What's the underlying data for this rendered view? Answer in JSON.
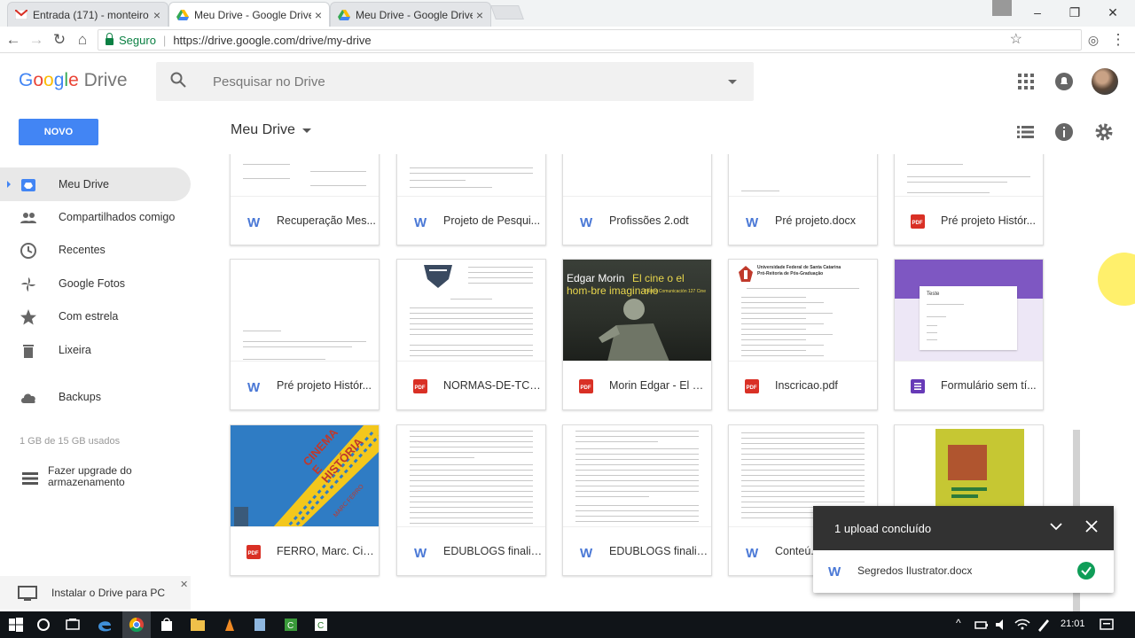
{
  "browser": {
    "tabs": [
      {
        "title": "Entrada (171) - monteiro",
        "icon": "gmail-icon"
      },
      {
        "title": "Meu Drive - Google Drive",
        "icon": "drive-icon",
        "active": true
      },
      {
        "title": "Meu Drive - Google Drive",
        "icon": "drive-icon"
      }
    ],
    "secure_label": "Seguro",
    "url": "https://drive.google.com/drive/my-drive"
  },
  "header": {
    "logo_google": "Google",
    "logo_drive": "Drive",
    "search_placeholder": "Pesquisar no Drive"
  },
  "toolbar": {
    "new_label": "NOVO",
    "title": "Meu Drive"
  },
  "sidebar": {
    "items": [
      {
        "label": "Meu Drive",
        "icon": "drive-icon"
      },
      {
        "label": "Compartilhados comigo",
        "icon": "people-icon"
      },
      {
        "label": "Recentes",
        "icon": "clock-icon"
      },
      {
        "label": "Google Fotos",
        "icon": "photos-icon"
      },
      {
        "label": "Com estrela",
        "icon": "star-icon"
      },
      {
        "label": "Lixeira",
        "icon": "trash-icon"
      },
      {
        "label": "Backups",
        "icon": "cloud-icon"
      }
    ],
    "storage": "1 GB de 15 GB usados",
    "upgrade_line1": "Fazer upgrade do",
    "upgrade_line2": "armazenamento",
    "install": "Instalar o Drive para PC"
  },
  "files": [
    {
      "name": "Recuperação Mes...",
      "type": "word"
    },
    {
      "name": "Projeto de Pesqui...",
      "type": "word"
    },
    {
      "name": "Profissões 2.odt",
      "type": "word"
    },
    {
      "name": "Pré projeto.docx",
      "type": "word"
    },
    {
      "name": "Pré projeto Histór...",
      "type": "pdf"
    },
    {
      "name": "Pré projeto Histór...",
      "type": "word"
    },
    {
      "name": "NORMAS-DE-TCC...",
      "type": "pdf"
    },
    {
      "name": "Morin Edgar - El C...",
      "type": "pdf"
    },
    {
      "name": "Inscricao.pdf",
      "type": "pdf"
    },
    {
      "name": "Formulário sem tí...",
      "type": "form"
    },
    {
      "name": "FERRO, Marc. Cin...",
      "type": "pdf"
    },
    {
      "name": "EDUBLOGS finaliz...",
      "type": "word"
    },
    {
      "name": "EDUBLOGS finaliz...",
      "type": "word"
    },
    {
      "name": "Conteú...",
      "type": "word"
    }
  ],
  "thumb_text": {
    "morin_author": "Edgar Morin",
    "morin_title": "El cine o el hom-bre imaginario",
    "morin_sub": "Paidós Comunicación 127 Cine",
    "form_title": "Teste",
    "ferro_title": "CINEMA E HISTÓRIA",
    "ferro_author": "MARC FERRO",
    "inscricao_head": "Universidade Federal de Santa Catarina",
    "inscricao_sub": "Pró-Reitoria de Pós-Graduação"
  },
  "upload": {
    "title": "1 upload concluído",
    "file": "Segredos Ilustrator.docx"
  },
  "taskbar": {
    "time": "21:01"
  },
  "colors": {
    "accent": "#4285f4",
    "word": "#4a78d6",
    "pdf": "#d93025",
    "form": "#673ab7",
    "success": "#0f9d58"
  }
}
